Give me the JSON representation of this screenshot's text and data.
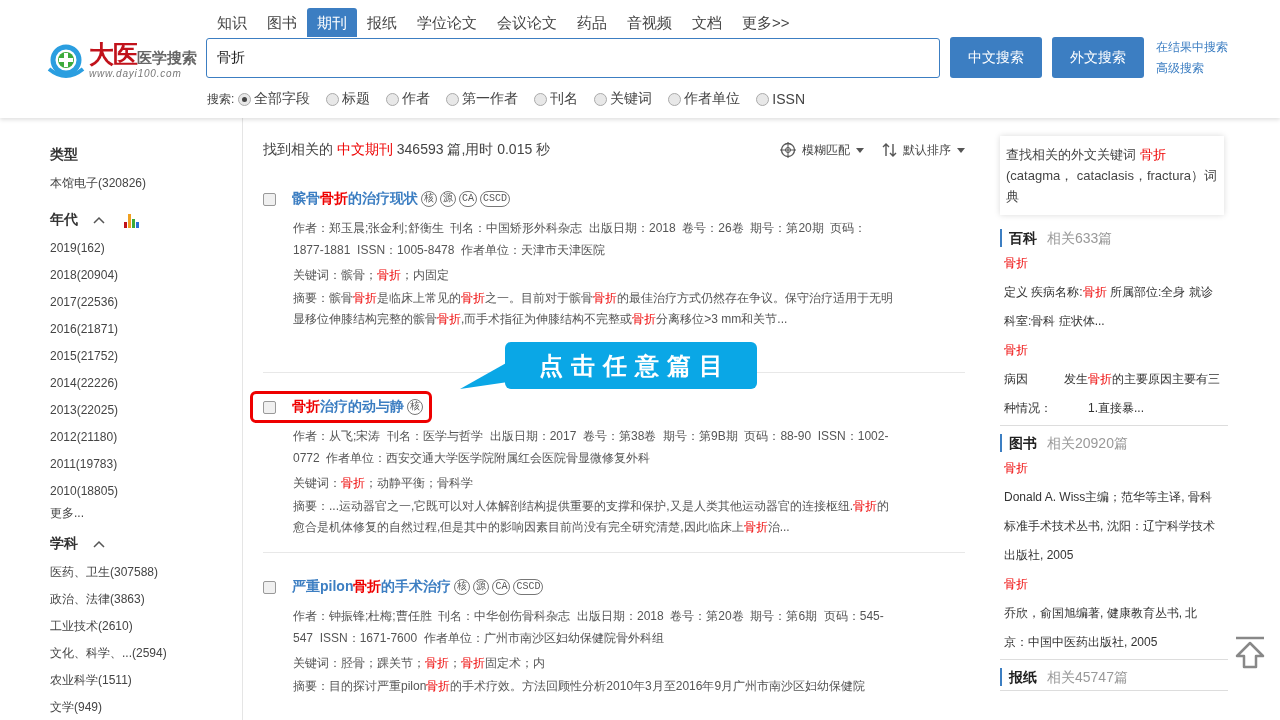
{
  "logo": {
    "brand": "大医",
    "tagline": "医学搜索",
    "url": "www.dayi100.com"
  },
  "tabs": [
    {
      "label": "知识",
      "selected": false
    },
    {
      "label": "图书",
      "selected": false
    },
    {
      "label": "期刊",
      "selected": true
    },
    {
      "label": "报纸",
      "selected": false
    },
    {
      "label": "学位论文",
      "selected": false
    },
    {
      "label": "会议论文",
      "selected": false
    },
    {
      "label": "药品",
      "selected": false
    },
    {
      "label": "音视频",
      "selected": false
    },
    {
      "label": "文档",
      "selected": false
    },
    {
      "label": "更多>>",
      "selected": false
    }
  ],
  "search": {
    "value": "骨折",
    "buttons": [
      "中文搜索",
      "外文搜索"
    ],
    "links": [
      "在结果中搜索",
      "高级搜索"
    ],
    "scope_label": "搜索:",
    "fields": [
      {
        "label": "全部字段",
        "selected": true
      },
      {
        "label": "标题",
        "selected": false
      },
      {
        "label": "作者",
        "selected": false
      },
      {
        "label": "第一作者",
        "selected": false
      },
      {
        "label": "刊名",
        "selected": false
      },
      {
        "label": "关键词",
        "selected": false
      },
      {
        "label": "作者单位",
        "selected": false
      },
      {
        "label": "ISSN",
        "selected": false
      }
    ]
  },
  "sidebar": {
    "groups": [
      {
        "title": "类型",
        "items": [
          "本馆电子(320826)"
        ]
      },
      {
        "title": "年代",
        "expanded": true,
        "has_chart": true,
        "items": [
          "2019(162)",
          "2018(20904)",
          "2017(22536)",
          "2016(21871)",
          "2015(21752)",
          "2014(22226)",
          "2013(22025)",
          "2012(21180)",
          "2011(19783)",
          "2010(18805)"
        ],
        "more": "更多..."
      },
      {
        "title": "学科",
        "expanded": true,
        "items": [
          "医药、卫生(307588)",
          "政治、法律(3863)",
          "工业技术(2610)",
          "文化、科学、...(2594)",
          "农业科学(1511)",
          "文学(949)"
        ]
      }
    ]
  },
  "results": {
    "summary": "找到相关的 **中文期刊** 346593 篇,用时 0.015 秒",
    "match": "模糊匹配",
    "sort": "默认排序",
    "items": [
      {
        "checked": false,
        "highlighted": false,
        "title": "髌骨**骨折**的治疗现状",
        "badges": [
          "核",
          "源",
          "CA",
          "CSCD"
        ],
        "meta": "作者：郑玉晨;张金利;舒衡生  刊名：中国矫形外科杂志  出版日期：2018  卷号：26卷  期号：第20期  页码：1877-1881  ISSN：1005-8478  作者单位：天津市天津医院",
        "keywords": "关键词：髌骨；**骨折**；内固定",
        "abstract": "摘要：髌骨**骨折**是临床上常见的**骨折**之一。目前对于髌骨**骨折**的最佳治疗方式仍然存在争议。保守治疗适用于无明显移位伸膝结构完整的髌骨**骨折**,而手术指征为伸膝结构不完整或**骨折**分离移位>3 mm和关节..."
      },
      {
        "checked": false,
        "highlighted": true,
        "title": "**骨折**治疗的动与静",
        "badges": [
          "核"
        ],
        "meta": "作者：从飞;宋涛  刊名：医学与哲学  出版日期：2017  卷号：第38卷  期号：第9B期  页码：88-90  ISSN：1002-0772  作者单位：西安交通大学医学院附属红会医院骨显微修复外科",
        "keywords": "关键词：**骨折**；动静平衡；骨科学",
        "abstract": "摘要：...运动器官之一,它既可以对人体解剖结构提供重要的支撑和保护,又是人类其他运动器官的连接枢纽.**骨折**的愈合是机体修复的自然过程,但是其中的影响因素目前尚没有完全研究清楚,因此临床上**骨折**治..."
      },
      {
        "checked": false,
        "highlighted": false,
        "title": "严重pilon**骨折**的手术治疗",
        "badges": [
          "核",
          "源",
          "CA",
          "CSCD"
        ],
        "meta": "作者：钟振锋;杜梅;曹任胜  刊名：中华创伤骨科杂志  出版日期：2018  卷号：第20卷  期号：第6期  页码：545-547  ISSN：1671-7600  作者单位：广州市南沙区妇幼保健院骨外科组",
        "keywords": "关键词：胫骨；踝关节；**骨折**；**骨折**固定术；内",
        "abstract": "摘要：目的探讨严重pilon**骨折**的手术疗效。方法回顾性分析2010年3月至2016年9月广州市南沙区妇幼保健院"
      }
    ]
  },
  "callout": {
    "text": "点击任意篇目"
  },
  "right": {
    "dictionary": "查找相关的外文关键词 **骨折** (catagma， cataclasis，fractura）词典",
    "sections": [
      {
        "title": "百科",
        "count": "相关633篇",
        "entries": [
          {
            "title": "骨折",
            "text": "定义 疾病名称:**骨折** 所属部位:全身 就诊科室:骨科 症状体..."
          },
          {
            "title": "骨折",
            "text": "病因　　　发生**骨折**的主要原因主要有三种情况：　　　1.直接暴..."
          }
        ]
      },
      {
        "title": "图书",
        "count": "相关20920篇",
        "entries": [
          {
            "title": "骨折",
            "text": "Donald A. Wiss主编；范华等主译, 骨科标准手术技术丛书, 沈阳：辽宁科学技术出版社, 2005"
          },
          {
            "title": "骨折",
            "text": "乔欣，俞国旭编著, 健康教育丛书, 北京：中国中医药出版社, 2005"
          }
        ]
      },
      {
        "title": "报纸",
        "count": "相关45747篇"
      }
    ]
  }
}
